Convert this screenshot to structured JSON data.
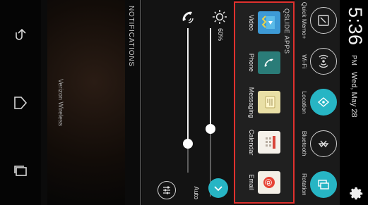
{
  "status_bar": {
    "time": "5:36",
    "ampm": "PM",
    "date": "Wed, May 28",
    "settings_icon": "gear-icon"
  },
  "quick_settings": [
    {
      "label": "Quick Memo+",
      "icon": "quick-memo-icon",
      "active": false
    },
    {
      "label": "Wi-Fi",
      "icon": "wifi-icon",
      "active": false
    },
    {
      "label": "Location",
      "icon": "location-icon",
      "active": true
    },
    {
      "label": "Bluetooth",
      "icon": "bluetooth-icon",
      "active": false
    },
    {
      "label": "Rotation",
      "icon": "rotation-icon",
      "active": true
    }
  ],
  "qslide": {
    "title": "QSLIDE APPS",
    "apps": [
      {
        "label": "Video",
        "icon": "video-icon"
      },
      {
        "label": "Phone",
        "icon": "phone-icon"
      },
      {
        "label": "Messaging",
        "icon": "messaging-icon"
      },
      {
        "label": "Calendar",
        "icon": "calendar-icon"
      },
      {
        "label": "Email",
        "icon": "email-icon"
      }
    ]
  },
  "brightness": {
    "percent_label": "60%",
    "level": 0.6,
    "auto_label": "Auto"
  },
  "volume": {
    "level": 0.8
  },
  "notifications": {
    "title": "NOTIFICATIONS",
    "carrier": "Verizon Wireless"
  },
  "colors": {
    "accent": "#27b5c4",
    "highlight_border": "#e0312e"
  },
  "nav": [
    "back-icon",
    "home-icon",
    "recent-apps-icon"
  ]
}
